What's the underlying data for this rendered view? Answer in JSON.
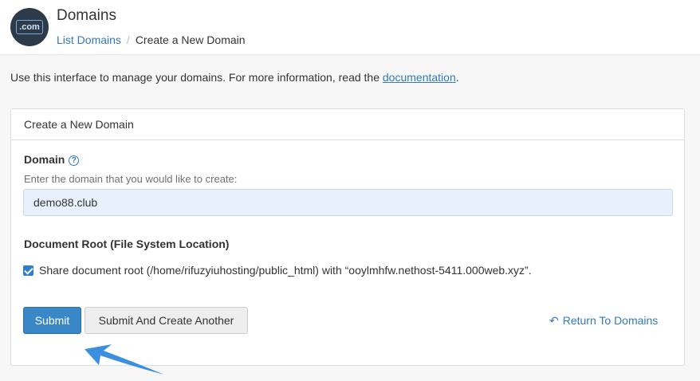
{
  "header": {
    "logo_text": ".com",
    "title": "Domains",
    "breadcrumb": {
      "parent": "List Domains",
      "separator": "/",
      "current": "Create a New Domain"
    }
  },
  "intro": {
    "text": "Use this interface to manage your domains. For more information, read the",
    "link": "documentation",
    "suffix": "."
  },
  "panel": {
    "heading": "Create a New Domain",
    "domain_label": "Domain",
    "domain_hint": "Enter the domain that you would like to create:",
    "domain_value": "demo88.club",
    "docroot_label": "Document Root (File System Location)",
    "share_label": "Share document root (/home/rifuzyiuhosting/public_html) with “ooylmhfw.nethost-5411.000web.xyz”.",
    "share_checked": true
  },
  "actions": {
    "submit": "Submit",
    "submit_another": "Submit And Create Another",
    "return": "Return To Domains"
  },
  "colors": {
    "primary": "#3a87c8",
    "link": "#337ab7",
    "arrow": "#3c8fe0"
  }
}
